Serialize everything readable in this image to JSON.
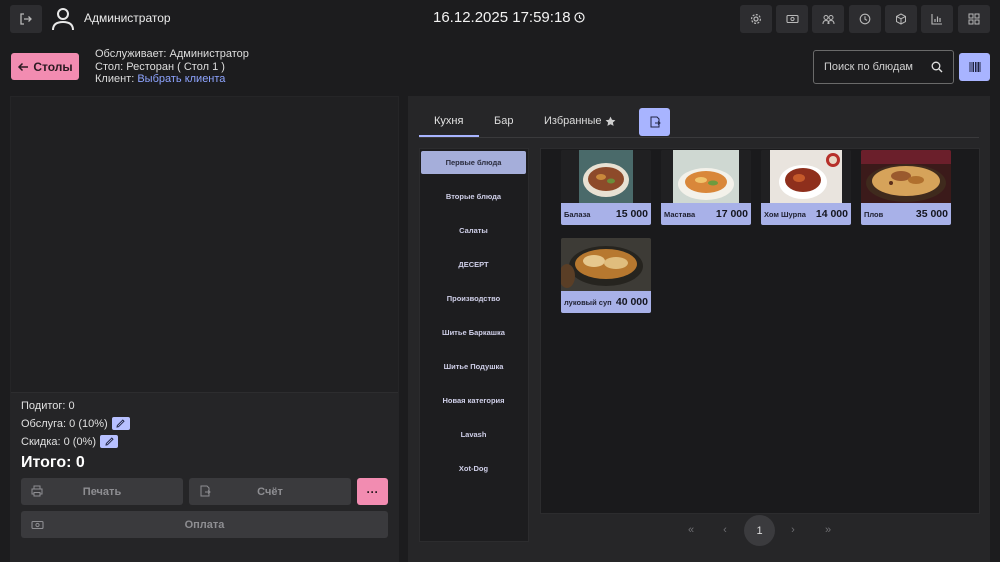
{
  "header": {
    "user_name": "Администратор",
    "datetime": "16.12.2025 17:59:18",
    "tools": [
      "gear-icon",
      "cash-icon",
      "staff-icon",
      "history-icon",
      "box-icon",
      "stats-icon",
      "grid-icon"
    ]
  },
  "order_info": {
    "back_label": "Столы",
    "served_by": "Обслуживает: Администратор",
    "table_prefix": "Стол: ",
    "table": "Ресторан ( Стол 1 )",
    "client_prefix": "Клиент: ",
    "client_link": "Выбрать клиента"
  },
  "search": {
    "placeholder": "Поиск по блюдам"
  },
  "summary": {
    "subtotal": "Подитог: 0",
    "service": "Обслуга: 0 (10%)",
    "discount": "Скидка: 0 (0%)",
    "total": "Итого: 0"
  },
  "actions": {
    "print_label": "Печать",
    "bill_label": "Счёт",
    "more_label": "···",
    "pay_label": "Оплата"
  },
  "tabs": [
    {
      "label": "Кухня",
      "active": true
    },
    {
      "label": "Бар",
      "active": false
    },
    {
      "label": "Избранные",
      "active": false
    }
  ],
  "categories": [
    {
      "label": "Первые блюда",
      "active": true
    },
    {
      "label": "Вторые блюда",
      "active": false
    },
    {
      "label": "Салаты",
      "active": false
    },
    {
      "label": "ДЕСЕРТ",
      "active": false
    },
    {
      "label": "Производство",
      "active": false
    },
    {
      "label": "Шитье Баркашка",
      "active": false
    },
    {
      "label": "Шитье Подушка",
      "active": false
    },
    {
      "label": "Новая категория",
      "active": false
    },
    {
      "label": "Lavash",
      "active": false
    },
    {
      "label": "Xot-Dog",
      "active": false
    }
  ],
  "dishes": [
    {
      "name": "Балаза",
      "price": "15 000"
    },
    {
      "name": "Мастава",
      "price": "17 000"
    },
    {
      "name": "Хом Шурпа",
      "price": "14 000"
    },
    {
      "name": "Плов",
      "price": "35 000"
    },
    {
      "name": "луковый суп",
      "price": "40 000"
    }
  ],
  "pagination": {
    "current": "1",
    "first": "«",
    "prev": "‹",
    "next": "›",
    "last": "»"
  },
  "colors": {
    "accent": "#a8b4ff",
    "pink": "#f28cb1",
    "background": "#1c1c1e",
    "panel": "#262628"
  }
}
